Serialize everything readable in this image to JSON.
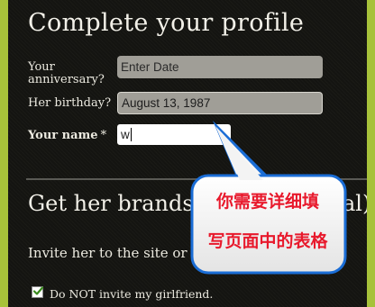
{
  "form": {
    "title": "Complete your profile",
    "anniversary_label": "Your anniversary?",
    "anniversary_placeholder": "Enter Date",
    "birthday_label": "Her birthday?",
    "birthday_value": "August 13, 1987",
    "name_label": "Your name",
    "name_required_mark": "*",
    "name_value": "w"
  },
  "section": {
    "heading": "Get her brands & ",
    "heading_tail": "al)",
    "invite_text": "Invite her to the site or ke",
    "checkbox_label": "Do NOT invite my girlfriend.",
    "checkbox_checked": true
  },
  "annotation": {
    "line1": "你需要详细填",
    "line2": "写页面中的表格",
    "text_color": "#e8192c"
  },
  "colors": {
    "page_border": "#a7c23a",
    "panel_bg": "#141411",
    "checkmark": "#3a8a1e"
  }
}
